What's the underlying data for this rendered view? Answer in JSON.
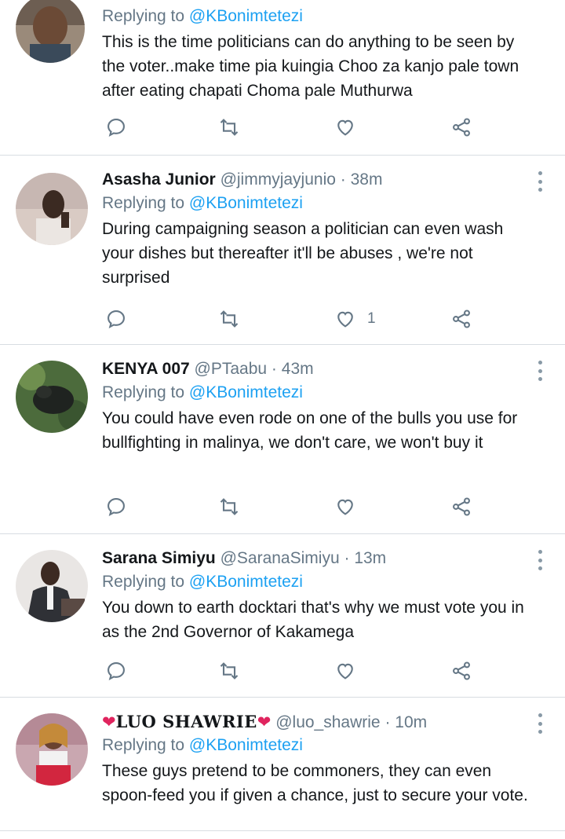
{
  "tweets": [
    {
      "name": "",
      "handle": "",
      "time": "",
      "replying_prefix": "Replying to",
      "replying_to": "@KBonimtetezi",
      "text": "This is the time politicians can do anything to be seen by the voter..make time pia kuingia Choo za kanjo pale town after eating chapati Choma pale Muthurwa",
      "likes": ""
    },
    {
      "name": "Asasha Junior",
      "handle": "@jimmyjayjunio",
      "time": "38m",
      "replying_prefix": "Replying to",
      "replying_to": "@KBonimtetezi",
      "text": "During campaigning season a politician can even wash your dishes but thereafter it'll be abuses , we're not surprised",
      "likes": "1"
    },
    {
      "name": "KENYA 007",
      "handle": "@PTaabu",
      "time": "43m",
      "replying_prefix": "Replying to",
      "replying_to": "@KBonimtetezi",
      "text": "You could have even rode on one of the bulls you use for bullfighting in malinya, we don't care, we won't buy it",
      "likes": ""
    },
    {
      "name": "Sarana Simiyu",
      "handle": "@SaranaSimiyu",
      "time": "13m",
      "replying_prefix": "Replying to",
      "replying_to": "@KBonimtetezi",
      "text": "You down to earth docktari that's why we must vote you in as the 2nd Governor of Kakamega",
      "likes": ""
    },
    {
      "name_left_emoji": "❤",
      "name": "LUO SHAWRIE",
      "name_right_emoji": "❤",
      "handle": "@luo_shawrie",
      "time": "10m",
      "replying_prefix": "Replying to",
      "replying_to": "@KBonimtetezi",
      "text": "These guys pretend to be commoners, they can even spoon-feed you if given a chance, just to secure your vote.",
      "likes": ""
    }
  ],
  "separator": "·",
  "icons": [
    "reply-icon",
    "retweet-icon",
    "like-icon",
    "share-icon",
    "more-options-icon"
  ],
  "colors": {
    "mention": "#1da1f2",
    "secondary_text": "#657786",
    "primary_text": "#14171a",
    "heart_emoji": "#e0245e"
  }
}
